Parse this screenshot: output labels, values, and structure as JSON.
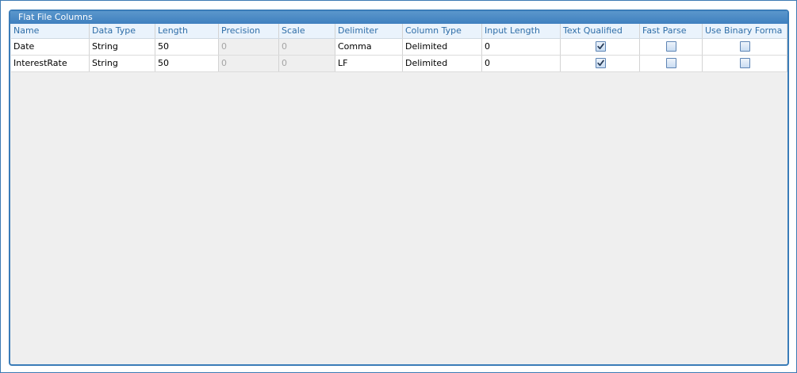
{
  "panel": {
    "title": "Flat File Columns"
  },
  "grid": {
    "columns": [
      {
        "key": "name",
        "label": "Name"
      },
      {
        "key": "data_type",
        "label": "Data Type"
      },
      {
        "key": "length",
        "label": "Length"
      },
      {
        "key": "precision",
        "label": "Precision"
      },
      {
        "key": "scale",
        "label": "Scale"
      },
      {
        "key": "delimiter",
        "label": "Delimiter"
      },
      {
        "key": "column_type",
        "label": "Column Type"
      },
      {
        "key": "input_length",
        "label": "Input Length"
      },
      {
        "key": "text_qualified",
        "label": "Text Qualified"
      },
      {
        "key": "fast_parse",
        "label": "Fast Parse"
      },
      {
        "key": "use_binary_format",
        "label": "Use Binary Forma"
      }
    ],
    "rows": [
      {
        "name": "Date",
        "data_type": "String",
        "length": "50",
        "precision": "0",
        "scale": "0",
        "delimiter": "Comma",
        "column_type": "Delimited",
        "input_length": "0",
        "text_qualified": true,
        "fast_parse": false,
        "use_binary_format": false
      },
      {
        "name": "InterestRate",
        "data_type": "String",
        "length": "50",
        "precision": "0",
        "scale": "0",
        "delimiter": "LF",
        "column_type": "Delimited",
        "input_length": "0",
        "text_qualified": true,
        "fast_parse": false,
        "use_binary_format": false
      }
    ]
  },
  "colors": {
    "accent": "#3a7cb8",
    "header_text": "#2f6ea8",
    "panel_background": "#efefef",
    "disabled_text": "#a5a5a5"
  },
  "icons": {
    "checked": "checkmark-icon"
  }
}
